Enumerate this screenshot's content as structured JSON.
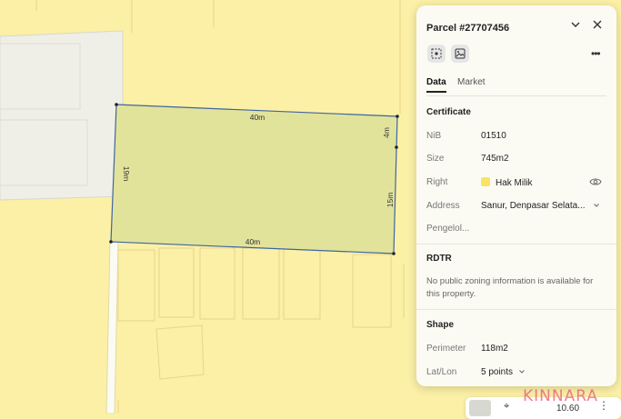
{
  "panel": {
    "title": "Parcel #27707456",
    "tabs": [
      {
        "label": "Data",
        "active": true
      },
      {
        "label": "Market",
        "active": false
      }
    ],
    "certificate": {
      "title": "Certificate",
      "rows": [
        {
          "label": "NiB",
          "value": "01510"
        },
        {
          "label": "Size",
          "value": "745m2"
        },
        {
          "label": "Right",
          "value": "Hak Milik"
        },
        {
          "label": "Address",
          "value": "Sanur, Denpasar Selata..."
        },
        {
          "label": "Pengelol..."
        }
      ]
    },
    "rdtr": {
      "title": "RDTR",
      "note": "No public zoning information is available for this property."
    },
    "shape": {
      "title": "Shape",
      "rows": [
        {
          "label": "Perimeter",
          "value": "118m2"
        },
        {
          "label": "Lat/Lon",
          "value": "5 points"
        }
      ]
    }
  },
  "map": {
    "parcel_edges": {
      "top": "40m",
      "bottom": "40m",
      "left": "19m",
      "right_upper": "4m",
      "right_lower": "15m"
    }
  },
  "bottom_card": {
    "value": "10.60"
  },
  "watermark": {
    "text": "KINNARA"
  },
  "colors": {
    "map_background": "#fbf0a6",
    "parcel_fill": "#e2e39b",
    "parcel_stroke": "#3f64a0",
    "right_swatch": "#f7e463",
    "watermark": "#f07d8e"
  }
}
